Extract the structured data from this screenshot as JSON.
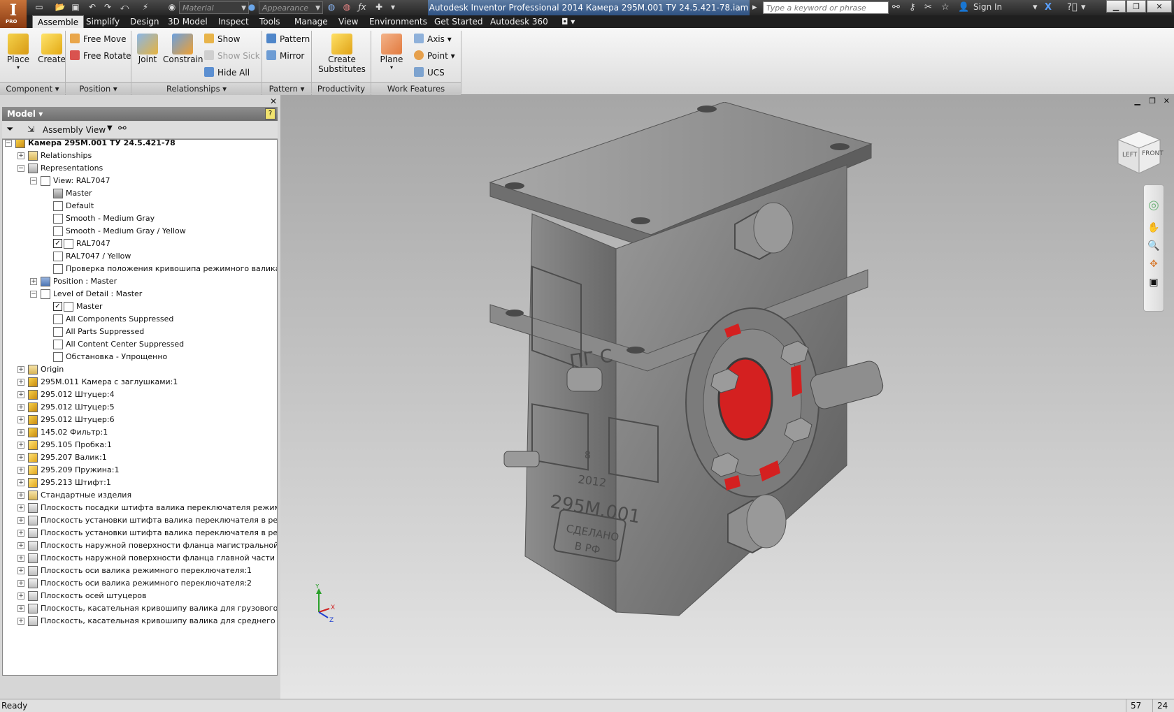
{
  "titlebar": {
    "app_icon_letter": "I",
    "app_icon_sub": "PRO",
    "material_placeholder": "Material",
    "appearance_placeholder": "Appearance",
    "title": "Autodesk Inventor Professional 2014    Камера 295М.001 ТУ 24.5.421-78.iam",
    "search_placeholder": "Type a keyword or phrase",
    "sign_in": "Sign In"
  },
  "tabs": [
    "Assemble",
    "Simplify",
    "Design",
    "3D Model",
    "Inspect",
    "Tools",
    "Manage",
    "View",
    "Environments",
    "Get Started",
    "Autodesk 360"
  ],
  "ribbon": {
    "component": {
      "label": "Component",
      "place": "Place",
      "create": "Create"
    },
    "position": {
      "label": "Position",
      "free_move": "Free Move",
      "free_rotate": "Free Rotate"
    },
    "relationships": {
      "label": "Relationships",
      "joint": "Joint",
      "constrain": "Constrain",
      "show": "Show",
      "show_sick": "Show Sick",
      "hide_all": "Hide All"
    },
    "pattern": {
      "label": "Pattern",
      "pattern": "Pattern",
      "mirror": "Mirror"
    },
    "productivity": {
      "label": "Productivity",
      "create_substitutes_1": "Create",
      "create_substitutes_2": "Substitutes"
    },
    "work_features": {
      "label": "Work Features",
      "plane": "Plane",
      "axis": "Axis",
      "point": "Point",
      "ucs": "UCS"
    }
  },
  "browser": {
    "header": "Model",
    "view_label": "Assembly View",
    "tree": [
      {
        "text": "Камера 295М.001 ТУ 24.5.421-78",
        "level": 0,
        "expander": "-",
        "icon": "assembly-icon",
        "bold": true
      },
      {
        "text": "Relationships",
        "level": 1,
        "expander": "+",
        "icon": "folder-icon"
      },
      {
        "text": "Representations",
        "level": 1,
        "expander": "-",
        "icon": "representations-icon"
      },
      {
        "text": "View: RAL7047",
        "level": 2,
        "expander": "-",
        "icon": "view-rep-icon"
      },
      {
        "text": "Master",
        "level": 3,
        "expander": "",
        "icon": "lock-icon"
      },
      {
        "text": "Default",
        "level": 3,
        "expander": "",
        "icon": "view-rep-icon"
      },
      {
        "text": "Smooth - Medium Gray",
        "level": 3,
        "expander": "",
        "icon": "view-rep-icon"
      },
      {
        "text": "Smooth - Medium Gray / Yellow",
        "level": 3,
        "expander": "",
        "icon": "view-rep-icon"
      },
      {
        "text": "RAL7047",
        "level": 3,
        "expander": "",
        "icon": "view-rep-icon",
        "check": true
      },
      {
        "text": "RAL7047 / Yellow",
        "level": 3,
        "expander": "",
        "icon": "view-rep-icon"
      },
      {
        "text": "Проверка положения кривошипа режимного валика",
        "level": 3,
        "expander": "",
        "icon": "view-rep-icon"
      },
      {
        "text": "Position : Master",
        "level": 2,
        "expander": "+",
        "icon": "position-rep-icon"
      },
      {
        "text": "Level of Detail : Master",
        "level": 2,
        "expander": "-",
        "icon": "lod-icon"
      },
      {
        "text": "Master",
        "level": 3,
        "expander": "",
        "icon": "lod-icon",
        "check": true
      },
      {
        "text": "All Components Suppressed",
        "level": 3,
        "expander": "",
        "icon": "lod-icon"
      },
      {
        "text": "All Parts Suppressed",
        "level": 3,
        "expander": "",
        "icon": "lod-icon"
      },
      {
        "text": "All Content Center Suppressed",
        "level": 3,
        "expander": "",
        "icon": "lod-icon"
      },
      {
        "text": "Обстановка - Упрощенно",
        "level": 3,
        "expander": "",
        "icon": "lod-icon"
      },
      {
        "text": "Origin",
        "level": 1,
        "expander": "+",
        "icon": "folder-icon"
      },
      {
        "text": "295М.011 Камера с заглушками:1",
        "level": 1,
        "expander": "+",
        "icon": "assembly-icon"
      },
      {
        "text": "295.012 Штуцер:4",
        "level": 1,
        "expander": "+",
        "icon": "assembly-icon"
      },
      {
        "text": "295.012 Штуцер:5",
        "level": 1,
        "expander": "+",
        "icon": "assembly-icon"
      },
      {
        "text": "295.012 Штуцер:6",
        "level": 1,
        "expander": "+",
        "icon": "assembly-icon"
      },
      {
        "text": "145.02 Фильтр:1",
        "level": 1,
        "expander": "+",
        "icon": "assembly-icon"
      },
      {
        "text": "295.105 Пробка:1",
        "level": 1,
        "expander": "+",
        "icon": "part-icon"
      },
      {
        "text": "295.207 Валик:1",
        "level": 1,
        "expander": "+",
        "icon": "part-icon"
      },
      {
        "text": "295.209 Пружина:1",
        "level": 1,
        "expander": "+",
        "icon": "part-icon"
      },
      {
        "text": "295.213 Штифт:1",
        "level": 1,
        "expander": "+",
        "icon": "part-icon"
      },
      {
        "text": "Стандартные изделия",
        "level": 1,
        "expander": "+",
        "icon": "folder-icon"
      },
      {
        "text": "Плоскость посадки штифта валика переключателя режимов",
        "level": 1,
        "expander": "+",
        "icon": "work-plane-icon"
      },
      {
        "text": "Плоскость установки штифта валика переключателя в режиме ПГ",
        "level": 1,
        "expander": "+",
        "icon": "work-plane-icon"
      },
      {
        "text": "Плоскость установки штифта валика переключателя в режиме С",
        "level": 1,
        "expander": "+",
        "icon": "work-plane-icon"
      },
      {
        "text": "Плоскость наружной поверхности фланца магистральной части",
        "level": 1,
        "expander": "+",
        "icon": "work-plane-icon"
      },
      {
        "text": "Плоскость наружной поверхности фланца главной части",
        "level": 1,
        "expander": "+",
        "icon": "work-plane-icon"
      },
      {
        "text": "Плоскость оси валика режимного переключателя:1",
        "level": 1,
        "expander": "+",
        "icon": "work-plane-icon"
      },
      {
        "text": "Плоскость оси валика режимного переключателя:2",
        "level": 1,
        "expander": "+",
        "icon": "work-plane-icon"
      },
      {
        "text": "Плоскость осей штуцеров",
        "level": 1,
        "expander": "+",
        "icon": "work-plane-icon"
      },
      {
        "text": "Плоскость, касательная кривошипу валика для грузового режима",
        "level": 1,
        "expander": "+",
        "icon": "work-plane-icon"
      },
      {
        "text": "Плоскость, касательная кривошипу валика для среднего режима",
        "level": 1,
        "expander": "+",
        "icon": "work-plane-icon"
      }
    ]
  },
  "viewcube": {
    "left": "LEFT",
    "front": "FRONT"
  },
  "model": {
    "cast_text_year": "2012",
    "cast_text_number": "295М.001",
    "cast_text_made_1": "СДЕЛАНО",
    "cast_text_made_2": "В РФ",
    "cast_text_letters": "ПГ С",
    "cast_text_8": "8"
  },
  "triad": {
    "x": "X",
    "y": "Y",
    "z": "Z"
  },
  "status": {
    "text": "Ready",
    "count1": "57",
    "count2": "24"
  },
  "colors": {
    "highlight_red": "#d42020",
    "model_gray": "#7a7a7a",
    "accent_blue": "#2f5283"
  }
}
